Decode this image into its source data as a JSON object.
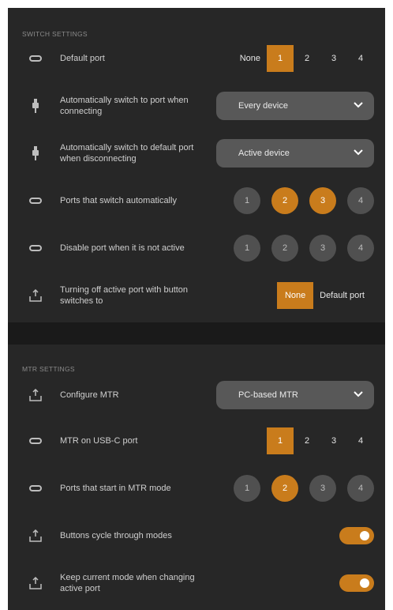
{
  "switch_settings": {
    "title": "SWITCH SETTINGS",
    "default_port": {
      "label": "Default port",
      "options": [
        "None",
        "1",
        "2",
        "3",
        "4"
      ],
      "selected": "1"
    },
    "auto_switch_connect": {
      "label": "Automatically switch to port when connecting",
      "value": "Every device"
    },
    "auto_switch_disconnect": {
      "label": "Automatically switch to default port when disconnecting",
      "value": "Active device"
    },
    "ports_switch_auto": {
      "label": "Ports that switch automatically",
      "ports": [
        "1",
        "2",
        "3",
        "4"
      ],
      "active": [
        "2",
        "3"
      ]
    },
    "disable_port": {
      "label": "Disable port when it is not active",
      "ports": [
        "1",
        "2",
        "3",
        "4"
      ],
      "active": []
    },
    "turn_off_active": {
      "label": "Turning off active port with button switches to",
      "options": [
        "None",
        "Default port"
      ],
      "selected": "None"
    }
  },
  "mtr_settings": {
    "title": "MTR SETTINGS",
    "configure_mtr": {
      "label": "Configure MTR",
      "value": "PC-based MTR"
    },
    "mtr_usbc": {
      "label": "MTR on USB-C port",
      "options": [
        "1",
        "2",
        "3",
        "4"
      ],
      "selected": "1"
    },
    "ports_start_mtr": {
      "label": "Ports that start in MTR mode",
      "ports": [
        "1",
        "2",
        "3",
        "4"
      ],
      "active": [
        "2"
      ]
    },
    "buttons_cycle": {
      "label": "Buttons cycle through modes",
      "enabled": true
    },
    "keep_mode": {
      "label": "Keep current mode when changing active port",
      "enabled": true
    }
  },
  "colors": {
    "accent": "#c97c1c",
    "panel": "#272727",
    "control_bg": "#585858"
  }
}
